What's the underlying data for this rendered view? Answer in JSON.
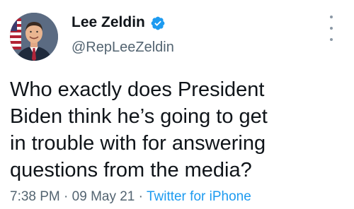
{
  "author": {
    "name": "Lee Zeldin",
    "handle": "@RepLeeZeldin",
    "verified": true
  },
  "tweet": {
    "lines": [
      "Who exactly does President",
      "Biden think he’s going to get",
      "in trouble with for answering",
      "questions from the media?"
    ]
  },
  "meta": {
    "time": "7:38 PM",
    "separator_1": " · ",
    "date": "09 May 21",
    "separator_2": " · ",
    "source": "Twitter for iPhone"
  },
  "icons": {
    "verified": "verified-badge-icon",
    "more": "more-options-icon"
  },
  "colors": {
    "text": "#0f1419",
    "secondary": "#536471",
    "accent": "#1d9bf0",
    "verified": "#1d9bf0"
  }
}
